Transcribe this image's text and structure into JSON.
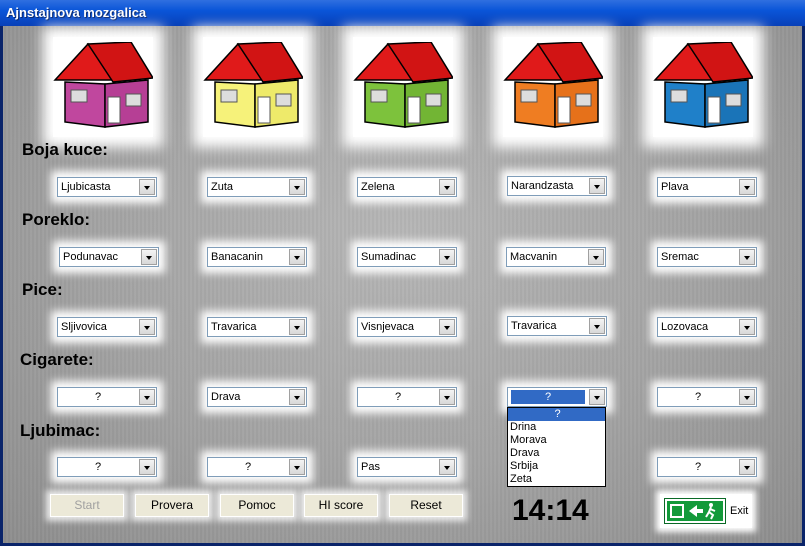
{
  "window": {
    "title": "Ajnstajnova mozgalica"
  },
  "houses": [
    {
      "name": "house-magenta",
      "wall": "#c0479e",
      "side": "#a33785"
    },
    {
      "name": "house-yellow",
      "wall": "#f6f27a",
      "side": "#d9d45a"
    },
    {
      "name": "house-green",
      "wall": "#7dc23c",
      "side": "#5c9c26"
    },
    {
      "name": "house-orange",
      "wall": "#ef7d22",
      "side": "#d06410"
    },
    {
      "name": "house-blue",
      "wall": "#1f80c9",
      "side": "#1565a6"
    }
  ],
  "sections": {
    "boja": {
      "label": "Boja kuce:",
      "values": [
        "Ljubicasta",
        "Zuta",
        "Zelena",
        "Narandzasta",
        "Plava"
      ]
    },
    "poreklo": {
      "label": "Poreklo:",
      "values": [
        "Podunavac",
        "Banacanin",
        "Sumadinac",
        "Macvanin",
        "Sremac"
      ]
    },
    "pice": {
      "label": "Pice:",
      "values": [
        "Sljivovica",
        "Travarica",
        "Visnjevaca",
        "Travarica",
        "Lozovaca"
      ]
    },
    "cigarete": {
      "label": "Cigarete:",
      "values": [
        "?",
        "Drava",
        "?",
        "?",
        "?"
      ]
    },
    "ljubimac": {
      "label": "Ljubimac:",
      "values": [
        "?",
        "?",
        "Pas",
        "",
        "?"
      ]
    }
  },
  "dropdown": {
    "options": [
      "?",
      "Drina",
      "Morava",
      "Drava",
      "Srbija",
      "Zeta"
    ],
    "selected": "?"
  },
  "buttons": {
    "start": "Start",
    "provera": "Provera",
    "pomoc": "Pomoc",
    "hiscore": "HI score",
    "reset": "Reset"
  },
  "timer": "14:14",
  "exit": {
    "label": "Exit"
  },
  "colors": {
    "roof": "#e01a1a",
    "selection": "#316ac5",
    "exit_sign": "#139a3a"
  }
}
